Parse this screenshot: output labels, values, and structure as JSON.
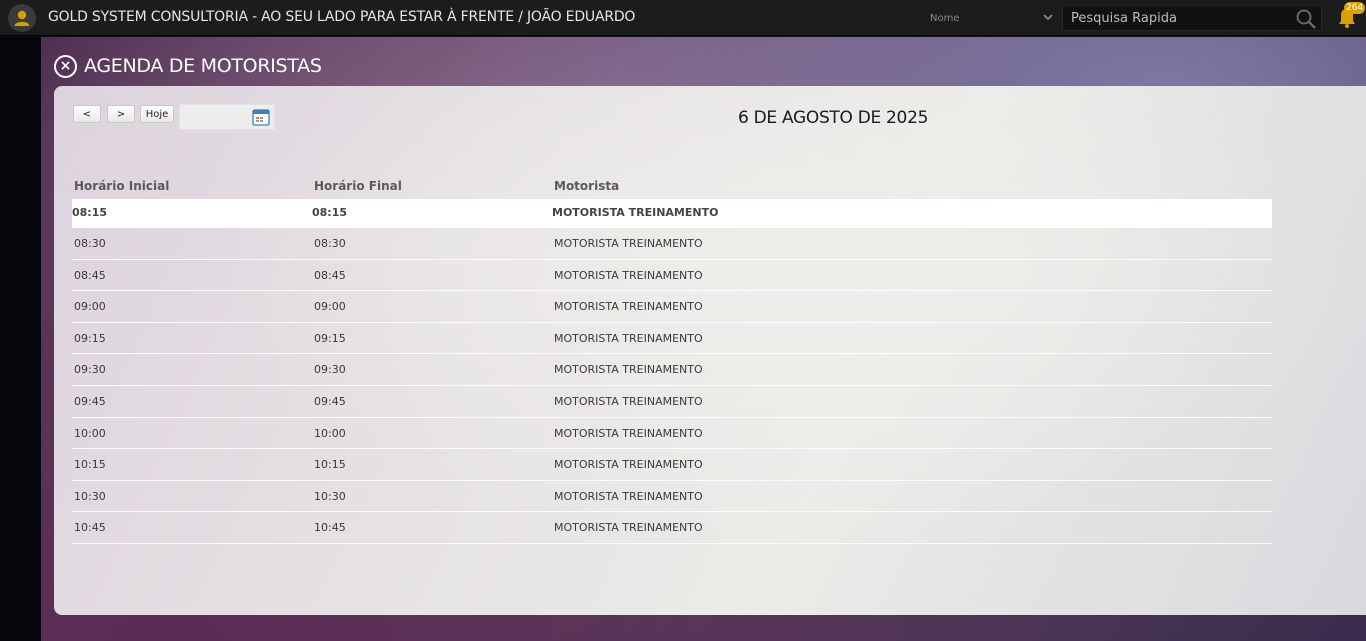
{
  "topbar": {
    "title": "GOLD SYSTEM CONSULTORIA - AO SEU LADO PARA ESTAR À FRENTE / JOÃO EDUARDO",
    "filter_label": "Nome",
    "search_placeholder": "Pesquisa Rapida",
    "notification_count": "264",
    "icons": {
      "avatar": "user-icon",
      "filter": "chevron-down-icon",
      "search": "search-icon",
      "bell": "bell-icon"
    },
    "accent_color": "#d8a100"
  },
  "page": {
    "title": "AGENDA DE MOTORISTAS",
    "close_icon": "close-icon"
  },
  "toolbar": {
    "prev_label": "<",
    "next_label": ">",
    "today_label": "Hoje",
    "calendar_icon": "calendar-icon",
    "current_date": "6 DE AGOSTO DE 2025"
  },
  "table": {
    "headers": [
      "Horário Inicial",
      "Horário Final",
      "Motorista"
    ],
    "rows": [
      {
        "start": "08:15",
        "end": "08:15",
        "driver": "MOTORISTA TREINAMENTO"
      },
      {
        "start": "08:30",
        "end": "08:30",
        "driver": "MOTORISTA TREINAMENTO"
      },
      {
        "start": "08:45",
        "end": "08:45",
        "driver": "MOTORISTA TREINAMENTO"
      },
      {
        "start": "09:00",
        "end": "09:00",
        "driver": "MOTORISTA TREINAMENTO"
      },
      {
        "start": "09:15",
        "end": "09:15",
        "driver": "MOTORISTA TREINAMENTO"
      },
      {
        "start": "09:30",
        "end": "09:30",
        "driver": "MOTORISTA TREINAMENTO"
      },
      {
        "start": "09:45",
        "end": "09:45",
        "driver": "MOTORISTA TREINAMENTO"
      },
      {
        "start": "10:00",
        "end": "10:00",
        "driver": "MOTORISTA TREINAMENTO"
      },
      {
        "start": "10:15",
        "end": "10:15",
        "driver": "MOTORISTA TREINAMENTO"
      },
      {
        "start": "10:30",
        "end": "10:30",
        "driver": "MOTORISTA TREINAMENTO"
      },
      {
        "start": "10:45",
        "end": "10:45",
        "driver": "MOTORISTA TREINAMENTO"
      }
    ]
  }
}
